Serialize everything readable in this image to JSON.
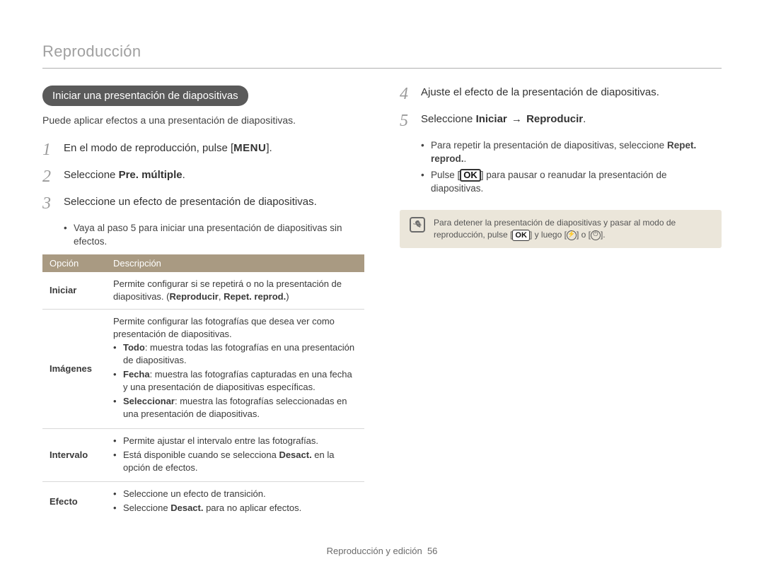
{
  "header": "Reproducción",
  "left": {
    "pill": "Iniciar una presentación de diapositivas",
    "intro": "Puede aplicar efectos a una presentación de diapositivas.",
    "step1_pre": "En el modo de reproducción, pulse [",
    "step1_key": "MENU",
    "step1_post": "].",
    "step2_pre": "Seleccione ",
    "step2_bold": "Pre. múltiple",
    "step2_post": ".",
    "step3": "Seleccione un efecto de presentación de diapositivas.",
    "step3_sub1": "Vaya al paso 5 para iniciar una presentación de diapositivas sin efectos.",
    "table": {
      "th_option": "Opción",
      "th_desc": "Descripción",
      "rows": {
        "iniciar": {
          "label": "Iniciar",
          "desc_pre": "Permite configurar si se repetirá o no la presentación de diapositivas. (",
          "b1": "Reproducir",
          "sep": ", ",
          "b2": "Repet. reprod.",
          "desc_post": ")"
        },
        "imagenes": {
          "label": "Imágenes",
          "intro": "Permite configurar las fotografías que desea ver como presentación de diapositivas.",
          "li1_b": "Todo",
          "li1": ": muestra todas las fotografías en una presentación de diapositivas.",
          "li2_b": "Fecha",
          "li2": ": muestra las fotografías capturadas en una fecha y una presentación de diapositivas específicas.",
          "li3_b": "Seleccionar",
          "li3": ": muestra las fotografías seleccionadas en una presentación de diapositivas."
        },
        "intervalo": {
          "label": "Intervalo",
          "li1": "Permite ajustar el intervalo entre las fotografías.",
          "li2_pre": "Está disponible cuando se selecciona ",
          "li2_b": "Desact.",
          "li2_post": " en la opción de efectos."
        },
        "efecto": {
          "label": "Efecto",
          "li1": "Seleccione un efecto de transición.",
          "li2_pre": "Seleccione ",
          "li2_b": "Desact.",
          "li2_post": " para no aplicar efectos."
        }
      }
    }
  },
  "right": {
    "step4": "Ajuste el efecto de la presentación de diapositivas.",
    "step5_pre": "Seleccione ",
    "step5_b1": "Iniciar",
    "step5_arrow": " → ",
    "step5_b2": "Reproducir",
    "step5_post": ".",
    "sub1_pre": "Para repetir la presentación de diapositivas, seleccione ",
    "sub1_b": "Repet. reprod.",
    "sub1_post": ".",
    "sub2_pre": "Pulse [",
    "sub2_key": "OK",
    "sub2_post": "] para pausar o reanudar la presentación de diapositivas.",
    "note_pre": "Para detener la presentación de diapositivas y pasar al modo de reproducción, pulse [",
    "note_key": "OK",
    "note_mid": "] y luego [",
    "note_or": "] o [",
    "note_end": "]."
  },
  "footer": {
    "section": "Reproducción y edición",
    "page": "56"
  }
}
